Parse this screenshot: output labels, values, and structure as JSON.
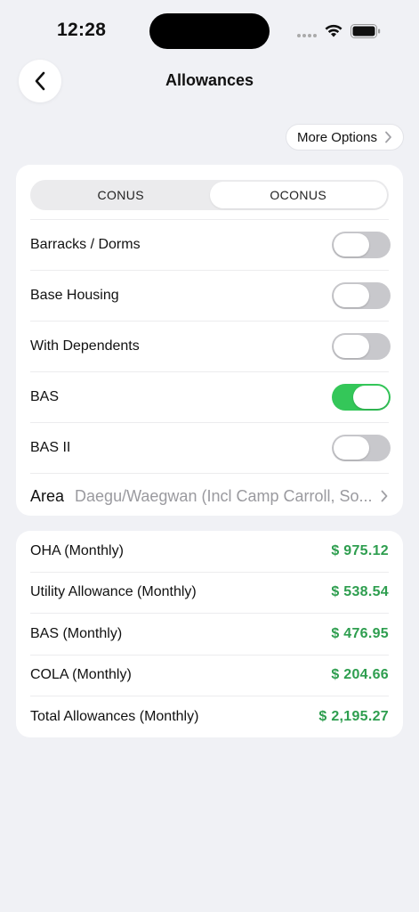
{
  "status": {
    "time": "12:28"
  },
  "nav": {
    "title": "Allowances",
    "back_icon": "chevron-left-icon",
    "more_options": "More Options"
  },
  "segments": {
    "items": [
      "CONUS",
      "OCONUS"
    ],
    "selected": "OCONUS"
  },
  "settings": [
    {
      "label": "Barracks / Dorms",
      "on": false
    },
    {
      "label": "Base Housing",
      "on": false
    },
    {
      "label": "With Dependents",
      "on": false
    },
    {
      "label": "BAS",
      "on": true
    },
    {
      "label": "BAS II",
      "on": false
    }
  ],
  "area": {
    "label": "Area",
    "value": "Daegu/Waegwan (Incl Camp Carroll, So..."
  },
  "summary": [
    {
      "label": "OHA (Monthly)",
      "amount": "$ 975.12"
    },
    {
      "label": "Utility Allowance (Monthly)",
      "amount": "$ 538.54"
    },
    {
      "label": "BAS (Monthly)",
      "amount": "$ 476.95"
    },
    {
      "label": "COLA (Monthly)",
      "amount": "$ 204.66"
    },
    {
      "label": "Total Allowances (Monthly)",
      "amount": "$ 2,195.27"
    }
  ],
  "colors": {
    "accent_green": "#34c759",
    "amount_green": "#2e9e4f",
    "background": "#f0f1f5"
  }
}
